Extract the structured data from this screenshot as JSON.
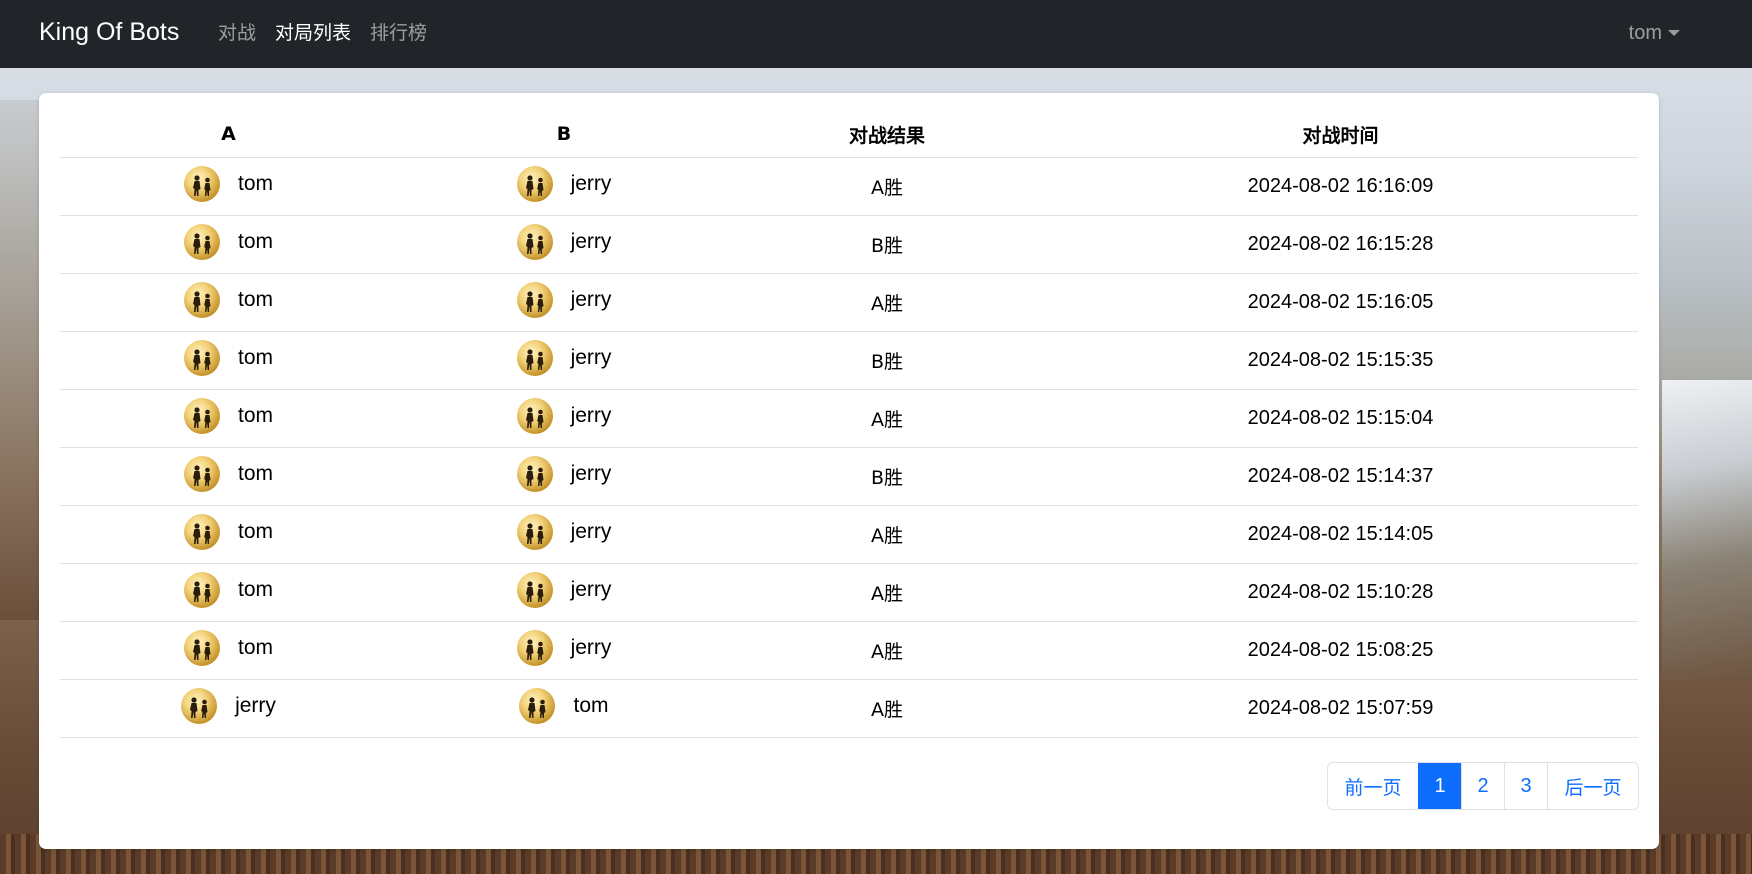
{
  "navbar": {
    "brand": "King Of Bots",
    "links": [
      {
        "label": "对战",
        "active": false
      },
      {
        "label": "对局列表",
        "active": true
      },
      {
        "label": "排行榜",
        "active": false
      }
    ],
    "user": "tom"
  },
  "table": {
    "headers": [
      "A",
      "B",
      "对战结果",
      "对战时间"
    ],
    "rows": [
      {
        "a": "tom",
        "b": "jerry",
        "result": "A胜",
        "time": "2024-08-02 16:16:09"
      },
      {
        "a": "tom",
        "b": "jerry",
        "result": "B胜",
        "time": "2024-08-02 16:15:28"
      },
      {
        "a": "tom",
        "b": "jerry",
        "result": "A胜",
        "time": "2024-08-02 15:16:05"
      },
      {
        "a": "tom",
        "b": "jerry",
        "result": "B胜",
        "time": "2024-08-02 15:15:35"
      },
      {
        "a": "tom",
        "b": "jerry",
        "result": "A胜",
        "time": "2024-08-02 15:15:04"
      },
      {
        "a": "tom",
        "b": "jerry",
        "result": "B胜",
        "time": "2024-08-02 15:14:37"
      },
      {
        "a": "tom",
        "b": "jerry",
        "result": "A胜",
        "time": "2024-08-02 15:14:05"
      },
      {
        "a": "tom",
        "b": "jerry",
        "result": "A胜",
        "time": "2024-08-02 15:10:28"
      },
      {
        "a": "tom",
        "b": "jerry",
        "result": "A胜",
        "time": "2024-08-02 15:08:25"
      },
      {
        "a": "jerry",
        "b": "tom",
        "result": "A胜",
        "time": "2024-08-02 15:07:59"
      }
    ]
  },
  "pagination": {
    "prev": "前一页",
    "pages": [
      "1",
      "2",
      "3"
    ],
    "active_page": "1",
    "next": "后一页"
  },
  "colors": {
    "navbar_bg": "#212529",
    "link_blue": "#0d6efd",
    "border": "#dee2e6"
  }
}
